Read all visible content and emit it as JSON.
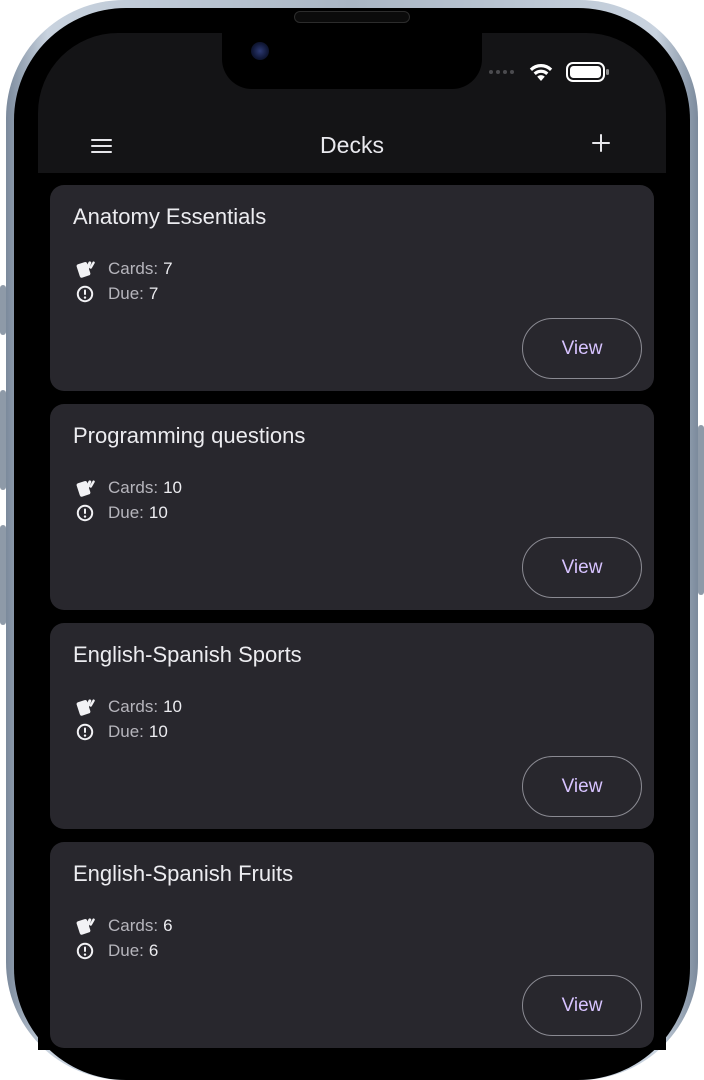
{
  "appbar": {
    "title": "Decks",
    "menu_icon": "hamburger-menu-icon",
    "add_icon": "plus-icon"
  },
  "status_bar": {
    "icons": [
      "signal-dots-icon",
      "wifi-icon",
      "battery-icon"
    ]
  },
  "labels": {
    "cards": "Cards:",
    "due": "Due:",
    "view": "View"
  },
  "decks": [
    {
      "title": "Anatomy Essentials",
      "cards": "7",
      "due": "7"
    },
    {
      "title": "Programming questions",
      "cards": "10",
      "due": "10"
    },
    {
      "title": "English-Spanish Sports",
      "cards": "10",
      "due": "10"
    },
    {
      "title": "English-Spanish Fruits",
      "cards": "6",
      "due": "6"
    }
  ],
  "colors": {
    "background": "#000000",
    "appbar": "#141416",
    "card": "#28272d",
    "accent_text": "#d7c3ff"
  }
}
